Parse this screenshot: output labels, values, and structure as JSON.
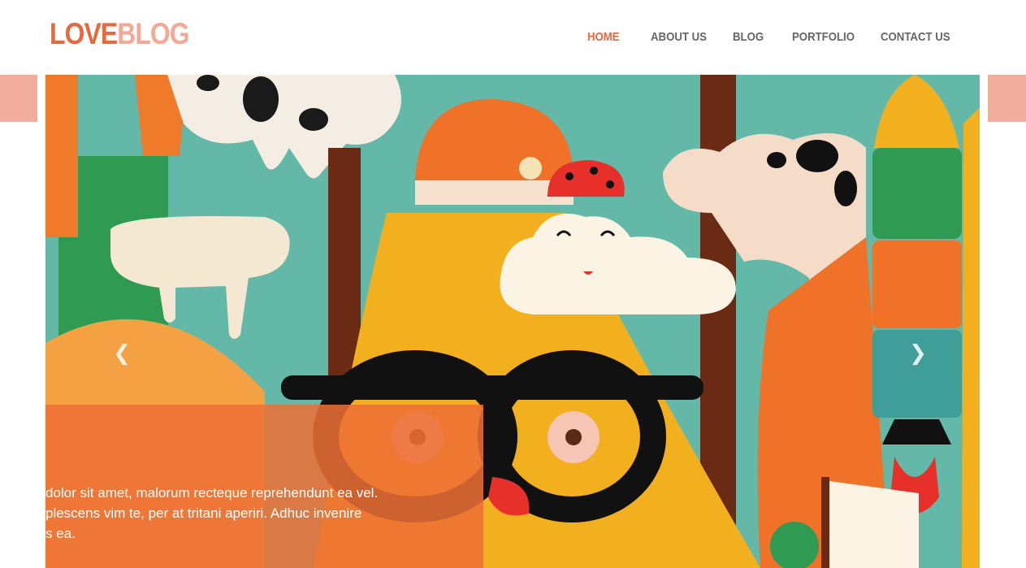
{
  "brand": {
    "part1": "LOVE",
    "part2": "BLOG"
  },
  "nav": [
    {
      "label": "HOME",
      "active": true
    },
    {
      "label": "ABOUT US",
      "active": false
    },
    {
      "label": "BLOG",
      "active": false
    },
    {
      "label": "PORTFOLIO",
      "active": false
    },
    {
      "label": "CONTACT US",
      "active": false
    }
  ],
  "slider": {
    "prev_icon": "chevron-left-icon",
    "next_icon": "chevron-right-icon",
    "caption_lines": [
      " dolor sit amet, malorum recteque reprehendunt ea vel.",
      "plescens vim te, per at tritani aperiri. Adhuc invenire",
      "s ea."
    ]
  },
  "colors": {
    "accent": "#e8683e",
    "accent_light": "#f2aa96",
    "nav_text": "#666666",
    "caption_bg": "#ec6f34",
    "side_bar": "#f2ae9d"
  }
}
